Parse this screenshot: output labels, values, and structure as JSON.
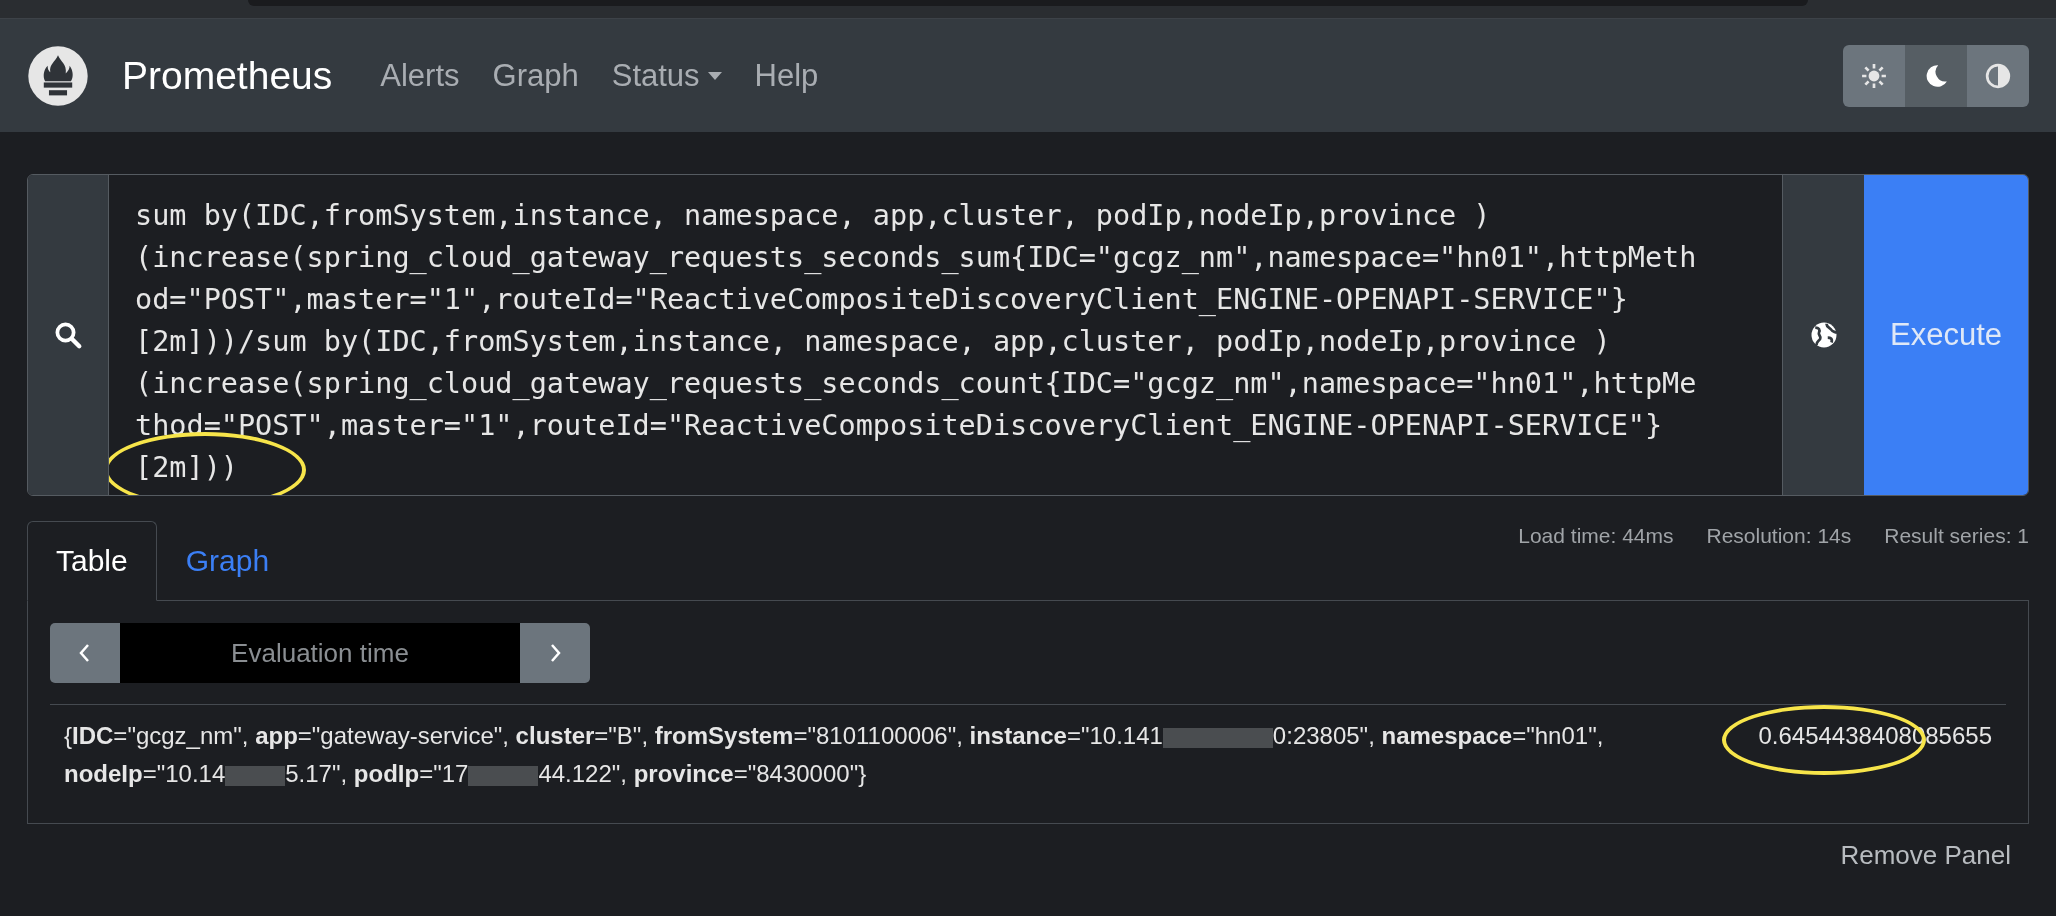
{
  "navbar": {
    "brand": "Prometheus",
    "links": [
      {
        "label": "Alerts",
        "dropdown": false
      },
      {
        "label": "Graph",
        "dropdown": false
      },
      {
        "label": "Status",
        "dropdown": true
      },
      {
        "label": "Help",
        "dropdown": false
      }
    ],
    "theme_buttons": [
      {
        "kind": "light",
        "selected": false
      },
      {
        "kind": "dark",
        "selected": true
      },
      {
        "kind": "auto",
        "selected": false
      }
    ]
  },
  "query": {
    "lines": [
      "sum by(IDC,fromSystem,instance, namespace, app,cluster, podIp,nodeIp,province )",
      "(increase(spring_cloud_gateway_requests_seconds_sum{IDC=\"gcgz_nm\",namespace=\"hn01\",httpMeth",
      "od=\"POST\",master=\"1\",routeId=\"ReactiveCompositeDiscoveryClient_ENGINE-OPENAPI-SERVICE\"}",
      "[2m]))/sum by(IDC,fromSystem,instance, namespace, app,cluster, podIp,nodeIp,province )",
      "(increase(spring_cloud_gateway_requests_seconds_count{IDC=\"gcgz_nm\",namespace=\"hn01\",httpMe",
      "thod=\"POST\",master=\"1\",routeId=\"ReactiveCompositeDiscoveryClient_ENGINE-OPENAPI-SERVICE\"}",
      "[2m]))"
    ],
    "execute": "Execute"
  },
  "tabs": [
    {
      "label": "Table",
      "selected": true
    },
    {
      "label": "Graph",
      "selected": false
    }
  ],
  "stats": [
    "Load time: 44ms",
    "Resolution: 14s",
    "Result series: 1"
  ],
  "evaluation_time": {
    "placeholder": "Evaluation time"
  },
  "result": {
    "labels_segments": [
      "{**IDC**=\"gcgz_nm\", **app**=\"gateway-service\", **cluster**=\"B\", **fromSystem**=\"8101100006\", **instance**=\"10.141",
      "0:23805\", **namespace**=\"hn01\", **nodeIp**=\"10.14",
      "5.17\", **podIp**=\"17",
      "44.122\", **province**=\"8430000\"}"
    ],
    "value": "0.6454438408085655"
  },
  "remove_panel": "Remove Panel"
}
